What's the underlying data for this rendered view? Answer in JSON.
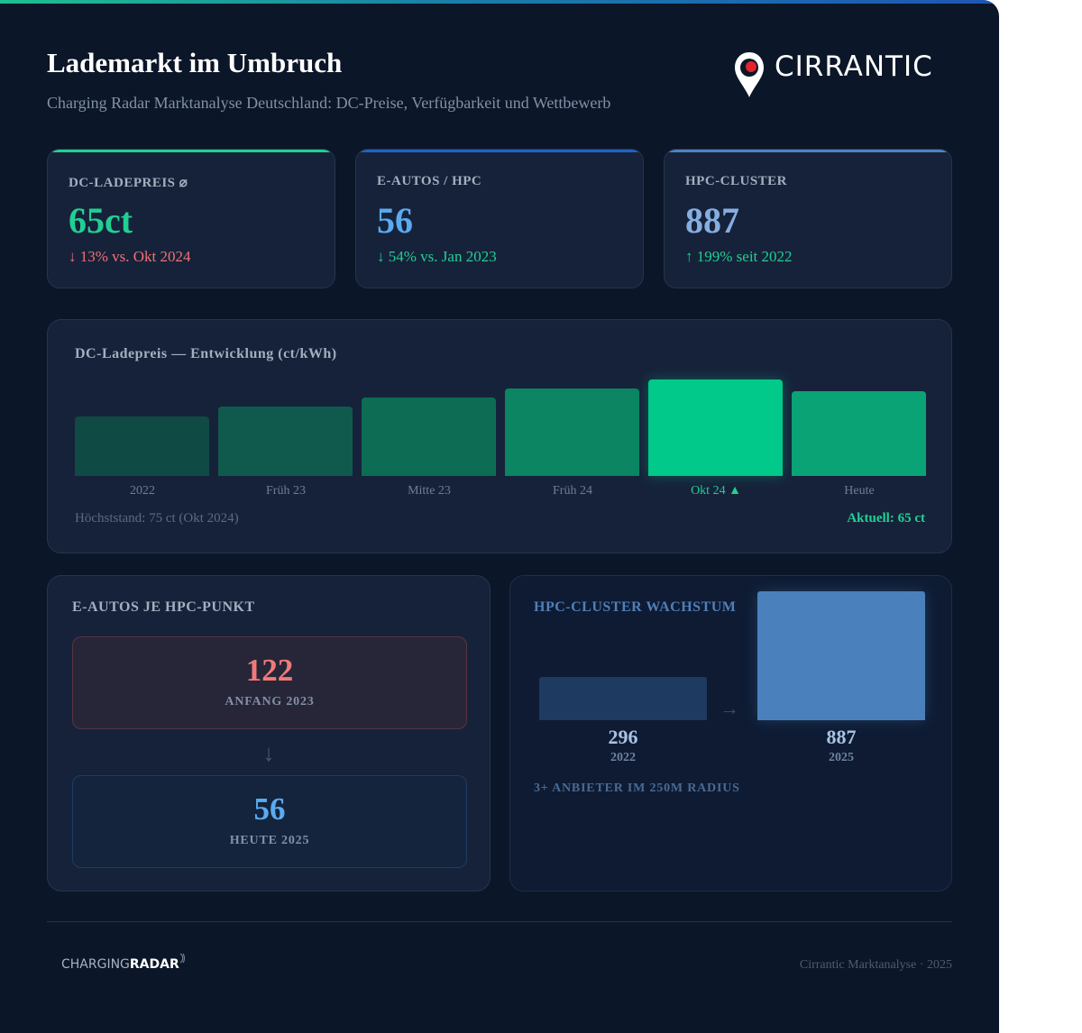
{
  "header": {
    "title": "Lademarkt im Umbruch",
    "subtitle": "Charging Radar Marktanalyse Deutschland: DC-Preise, Verfügbarkeit und Wettbewerb",
    "logo_text": "CIRRANTIC"
  },
  "kpis": [
    {
      "label": "DC-LADEPREIS ⌀",
      "value": "65ct",
      "delta": "↓ 13% vs. Okt 2024",
      "accent": "#22cf93",
      "value_color": "#22cf93",
      "delta_color": "#f07070"
    },
    {
      "label": "E-AUTOS / HPC",
      "value": "56",
      "delta": "↓ 54% vs. Jan 2023",
      "accent": "#1f63c4",
      "value_color": "#5aaaf0",
      "delta_color": "#22cf93"
    },
    {
      "label": "HPC-CLUSTER",
      "value": "887",
      "delta": "↑ 199% seit 2022",
      "accent": "#4f82c2",
      "value_color": "#86aee0",
      "delta_color": "#22cf93"
    }
  ],
  "chart_data": {
    "type": "bar",
    "title": "DC-Ladepreis — Entwicklung (ct/kWh)",
    "categories": [
      "2022",
      "Früh 23",
      "Mitte 23",
      "Früh 24",
      "Okt 24 ▲",
      "Heute"
    ],
    "values": [
      46,
      54,
      61,
      68,
      75,
      66
    ],
    "ylim": [
      0,
      75
    ],
    "colors": [
      "#0f4a45",
      "#0f5a4c",
      "#0d6d54",
      "#0b8562",
      "#00c98a",
      "#0aa376"
    ],
    "highlight_index": 4,
    "note": "Höchststand: 75 ct (Okt 2024)",
    "current": "Aktuell: 65 ct"
  },
  "ev_per_hpc": {
    "title": "E-AUTOS JE HPC-PUNKT",
    "before": {
      "value": "122",
      "label": "ANFANG 2023"
    },
    "arrow": "↓",
    "after": {
      "value": "56",
      "label": "HEUTE 2025"
    }
  },
  "cluster_growth": {
    "title": "HPC-CLUSTER WACHSTUM",
    "items": [
      {
        "value": 296,
        "label": "296",
        "year": "2022",
        "color": "#1f3a60"
      },
      {
        "value": 887,
        "label": "887",
        "year": "2025",
        "color": "#4a80bb"
      }
    ],
    "arrow": "→",
    "note": "3+ ANBIETER IM 250M RADIUS"
  },
  "footer": {
    "brand_light": "CHARGING",
    "brand_bold": "RADAR",
    "right": "Cirrantic Marktanalyse · 2025"
  }
}
